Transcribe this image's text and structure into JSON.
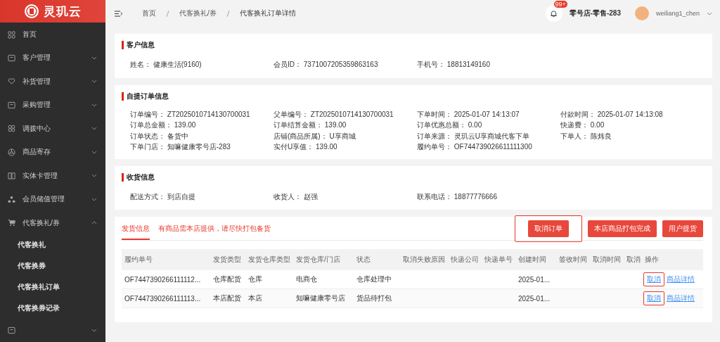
{
  "brand": {
    "name": "灵玑云"
  },
  "sidebar": {
    "items": [
      {
        "label": "首页",
        "kind": "link"
      },
      {
        "label": "客户管理",
        "kind": "group",
        "expanded": false
      },
      {
        "label": "补货管理",
        "kind": "group",
        "expanded": false
      },
      {
        "label": "采购管理",
        "kind": "group",
        "expanded": false
      },
      {
        "label": "调拨中心",
        "kind": "group",
        "expanded": false
      },
      {
        "label": "商品寄存",
        "kind": "group",
        "expanded": false
      },
      {
        "label": "实体卡管理",
        "kind": "group",
        "expanded": false
      },
      {
        "label": "会员储值管理",
        "kind": "group",
        "expanded": false
      },
      {
        "label": "代客换礼/券",
        "kind": "group",
        "expanded": true,
        "children": [
          {
            "label": "代客换礼"
          },
          {
            "label": "代客换券"
          },
          {
            "label": "代客换礼订单"
          },
          {
            "label": "代客换券记录"
          }
        ]
      },
      {
        "kind": "group",
        "expanded": false
      }
    ]
  },
  "breadcrumb": [
    "首页",
    "代客换礼/券",
    "代客换礼订单详情"
  ],
  "header": {
    "badge": "99+",
    "store": "零号店-零售-283",
    "user": "weiliang1_chen"
  },
  "sections": [
    {
      "title": "客户信息",
      "fields": [
        {
          "label": "姓名：",
          "value": "健康生活(9160)"
        },
        {
          "label": "会员ID：",
          "value": "7371007205359863163"
        },
        {
          "label": "手机号：",
          "value": "18813149160"
        }
      ]
    },
    {
      "title": "自提订单信息",
      "fields": [
        {
          "label": "订单编号：",
          "value": "ZT2025010714130700031"
        },
        {
          "label": "父单编号：",
          "value": "ZT2025010714130700031"
        },
        {
          "label": "下单时间：",
          "value": "2025-01-07 14:13:07"
        },
        {
          "label": "付款时间：",
          "value": "2025-01-07 14:13:08"
        },
        {
          "label": "订单总金额：",
          "value": "139.00"
        },
        {
          "label": "订单结算金额：",
          "value": "139.00"
        },
        {
          "label": "订单优惠总额：",
          "value": "0.00"
        },
        {
          "label": "快递费：",
          "value": "0.00"
        },
        {
          "label": "订单状态：",
          "value": "备货中"
        },
        {
          "label": "店铺(商品所属)：",
          "value": "U享商城"
        },
        {
          "label": "订单来源：",
          "value": "灵玑云U享商城代客下单"
        },
        {
          "label": "下单人：",
          "value": "陈炜良"
        },
        {
          "label": "下单门店：",
          "value": "知嘛健康零号店-283"
        },
        {
          "label": "实付U享值：",
          "value": "139.00"
        },
        {
          "label": "履约单号：",
          "value": "OF744739026611111300"
        }
      ]
    },
    {
      "title": "收货信息",
      "fields": [
        {
          "label": "配送方式：",
          "value": "到店自提"
        },
        {
          "label": "收货人：",
          "value": "赵强"
        },
        {
          "label": "联系电话：",
          "value": "18877776666"
        }
      ]
    }
  ],
  "shipping": {
    "tab": "发货信息",
    "notice": "有商品需本店提供，请尽快打包备货",
    "buttons": [
      {
        "label": "取消订单",
        "highlighted": true
      },
      {
        "label": "本店商品打包完成",
        "highlighted": false
      },
      {
        "label": "用户提货",
        "highlighted": false
      }
    ],
    "columns": [
      "履约单号",
      "发货类型",
      "发货仓库类型",
      "发货仓库/门店",
      "状态",
      "取消失败原因",
      "快递公司",
      "快递单号",
      "创建时间",
      "签收时间",
      "取消时间",
      "取消",
      "操作"
    ],
    "rows": [
      {
        "cells": [
          "OF7447390266111112...",
          "仓库配货",
          "仓库",
          "电商仓",
          "仓库处理中",
          "",
          "",
          "",
          "2025-01...",
          "",
          "",
          ""
        ],
        "actions": [
          {
            "label": "取消",
            "highlighted": true
          },
          {
            "label": "商品详情",
            "highlighted": false
          }
        ]
      },
      {
        "cells": [
          "OF7447390266111113...",
          "本店配货",
          "本店",
          "知嘛健康零号店",
          "货品待打包",
          "",
          "",
          "",
          "2025-01...",
          "",
          "",
          ""
        ],
        "actions": [
          {
            "label": "取消",
            "highlighted": true
          },
          {
            "label": "商品详情",
            "highlighted": false
          }
        ]
      }
    ]
  }
}
